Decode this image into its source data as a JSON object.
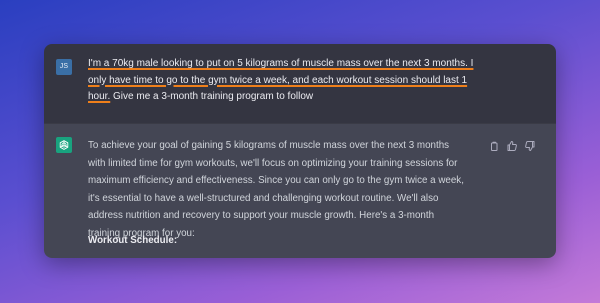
{
  "conversation": {
    "user": {
      "avatar_initials": "JS",
      "message_highlighted": "I'm a 70kg male looking to put on 5 kilograms of muscle mass over the next 3 months. I only have time to go to the gym twice a week, and each workout session should last 1 hour.",
      "message_rest": " Give me a 3-month training program to follow",
      "highlight_color": "#ef7f1a"
    },
    "assistant": {
      "avatar_icon": "openai-logo-icon",
      "message": "To achieve your goal of gaining 5 kilograms of muscle mass over the next 3 months with limited time for gym workouts, we'll focus on optimizing your training sessions for maximum efficiency and effectiveness. Since you can only go to the gym twice a week, it's essential to have a well-structured and challenging workout routine. We'll also address nutrition and recovery to support your muscle growth. Here's a 3-month training program for you:",
      "section_heading": "Workout Schedule:",
      "actions": [
        "copy-icon",
        "thumbs-up-icon",
        "thumbs-down-icon"
      ]
    }
  }
}
